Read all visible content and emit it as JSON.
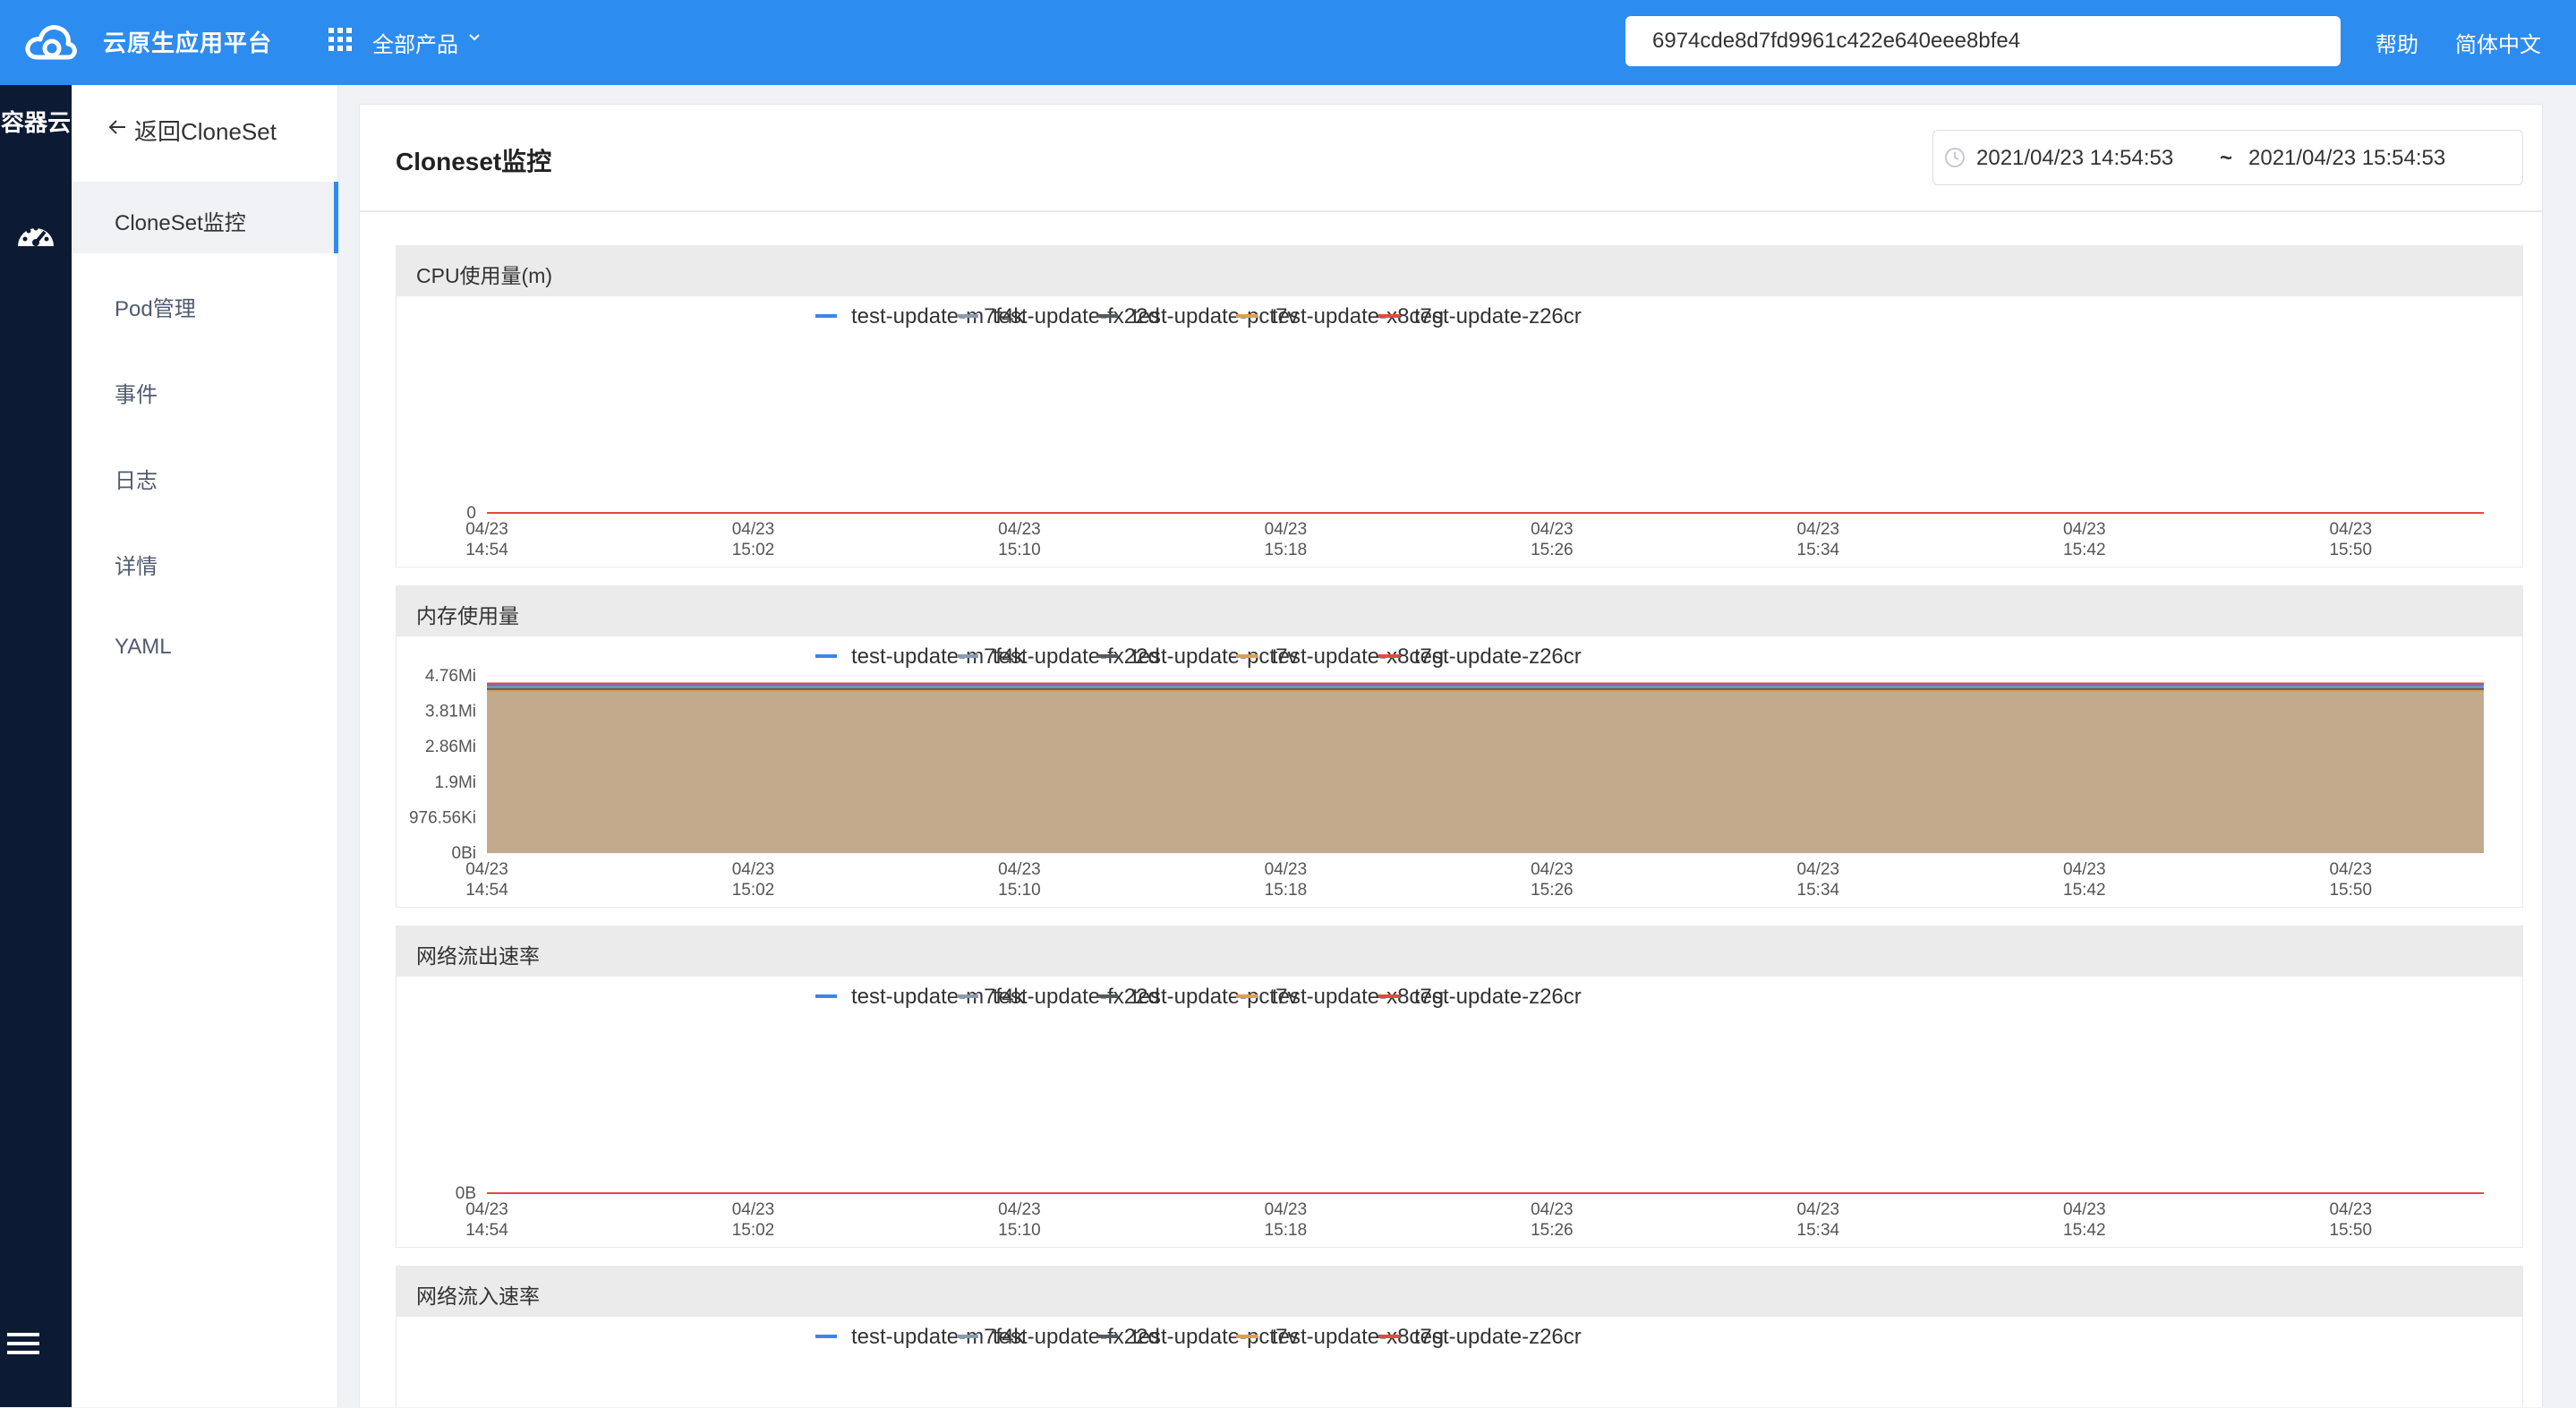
{
  "header": {
    "app_title": "云原生应用平台",
    "products_label": "全部产品",
    "search_value": "6974cde8d7fd9961c422e640eee8bfe4",
    "help_label": "帮助",
    "language_label": "简体中文"
  },
  "rail": {
    "title": "容器云",
    "icons": [
      "dashboard-icon",
      "menu-icon"
    ]
  },
  "sidebar": {
    "back_label": "返回CloneSet",
    "items": [
      {
        "label": "CloneSet监控",
        "active": true
      },
      {
        "label": "Pod管理",
        "active": false
      },
      {
        "label": "事件",
        "active": false
      },
      {
        "label": "日志",
        "active": false
      },
      {
        "label": "详情",
        "active": false
      },
      {
        "label": "YAML",
        "active": false
      }
    ]
  },
  "main": {
    "title": "Cloneset监控",
    "date_start": "2021/04/23 14:54:53",
    "date_separator": "~",
    "date_end": "2021/04/23 15:54:53"
  },
  "colors": {
    "primary": "#2d8cf0",
    "rail_bg": "#0c1a33",
    "area_fill": "#c2a98b"
  },
  "chart_data": [
    {
      "type": "line",
      "title": "CPU使用量(m)",
      "x": [
        "04/23\n14:54",
        "04/23\n15:02",
        "04/23\n15:10",
        "04/23\n15:18",
        "04/23\n15:26",
        "04/23\n15:34",
        "04/23\n15:42",
        "04/23\n15:50"
      ],
      "y_ticks": [
        "0"
      ],
      "legend_position": "top-center",
      "series": [
        {
          "name": "test-update-m7f4k",
          "color": "#3a86e8",
          "values": [
            0,
            0,
            0,
            0,
            0,
            0,
            0,
            0
          ]
        },
        {
          "name": "test-update-fx22d",
          "color": "#8a9bb0",
          "values": [
            0,
            0,
            0,
            0,
            0,
            0,
            0,
            0
          ]
        },
        {
          "name": "test-update-pct7v",
          "color": "#555a60",
          "values": [
            0,
            0,
            0,
            0,
            0,
            0,
            0,
            0
          ]
        },
        {
          "name": "test-update-x8c7g",
          "color": "#d9a24a",
          "values": [
            0,
            0,
            0,
            0,
            0,
            0,
            0,
            0
          ]
        },
        {
          "name": "test-update-z26cr",
          "color": "#e8473d",
          "values": [
            0,
            0,
            0,
            0,
            0,
            0,
            0,
            0
          ]
        }
      ]
    },
    {
      "type": "area",
      "title": "内存使用量",
      "x": [
        "04/23\n14:54",
        "04/23\n15:02",
        "04/23\n15:10",
        "04/23\n15:18",
        "04/23\n15:26",
        "04/23\n15:34",
        "04/23\n15:42",
        "04/23\n15:50"
      ],
      "y_ticks": [
        "0Bi",
        "976.56Ki",
        "1.9Mi",
        "2.86Mi",
        "3.81Mi",
        "4.76Mi"
      ],
      "ylim_mi": [
        0,
        4.76
      ],
      "legend_position": "top-center",
      "series": [
        {
          "name": "test-update-m7f4k",
          "color": "#3a86e8",
          "values_mi": [
            4.5,
            4.5,
            4.5,
            4.5,
            4.5,
            4.5,
            4.5,
            4.5
          ]
        },
        {
          "name": "test-update-fx22d",
          "color": "#8a9bb0",
          "values_mi": [
            4.45,
            4.45,
            4.45,
            4.45,
            4.45,
            4.45,
            4.45,
            4.45
          ]
        },
        {
          "name": "test-update-pct7v",
          "color": "#555a60",
          "values_mi": [
            4.4,
            4.4,
            4.4,
            4.4,
            4.4,
            4.4,
            4.4,
            4.4
          ]
        },
        {
          "name": "test-update-x8c7g",
          "color": "#d9a24a",
          "values_mi": [
            4.35,
            4.35,
            4.35,
            4.35,
            4.35,
            4.35,
            4.35,
            4.35
          ]
        },
        {
          "name": "test-update-z26cr",
          "color": "#e8473d",
          "values_mi": [
            4.55,
            4.55,
            4.55,
            4.55,
            4.55,
            4.55,
            4.55,
            4.55
          ]
        }
      ]
    },
    {
      "type": "line",
      "title": "网络流出速率",
      "x": [
        "04/23\n14:54",
        "04/23\n15:02",
        "04/23\n15:10",
        "04/23\n15:18",
        "04/23\n15:26",
        "04/23\n15:34",
        "04/23\n15:42",
        "04/23\n15:50"
      ],
      "y_ticks": [
        "0B"
      ],
      "legend_position": "top-center",
      "series": [
        {
          "name": "test-update-m7f4k",
          "color": "#3a86e8",
          "values": [
            0,
            0,
            0,
            0,
            0,
            0,
            0,
            0
          ]
        },
        {
          "name": "test-update-fx22d",
          "color": "#8a9bb0",
          "values": [
            0,
            0,
            0,
            0,
            0,
            0,
            0,
            0
          ]
        },
        {
          "name": "test-update-pct7v",
          "color": "#555a60",
          "values": [
            0,
            0,
            0,
            0,
            0,
            0,
            0,
            0
          ]
        },
        {
          "name": "test-update-x8c7g",
          "color": "#d9a24a",
          "values": [
            0,
            0,
            0,
            0,
            0,
            0,
            0,
            0
          ]
        },
        {
          "name": "test-update-z26cr",
          "color": "#e8473d",
          "values": [
            0,
            0,
            0,
            0,
            0,
            0,
            0,
            0
          ]
        }
      ]
    },
    {
      "type": "line",
      "title": "网络流入速率",
      "x": [],
      "y_ticks": [],
      "legend_position": "top-center",
      "series": [
        {
          "name": "test-update-m7f4k",
          "color": "#3a86e8",
          "values": []
        },
        {
          "name": "test-update-fx22d",
          "color": "#8a9bb0",
          "values": []
        },
        {
          "name": "test-update-pct7v",
          "color": "#555a60",
          "values": []
        },
        {
          "name": "test-update-x8c7g",
          "color": "#d9a24a",
          "values": []
        },
        {
          "name": "test-update-z26cr",
          "color": "#e8473d",
          "values": []
        }
      ]
    }
  ]
}
